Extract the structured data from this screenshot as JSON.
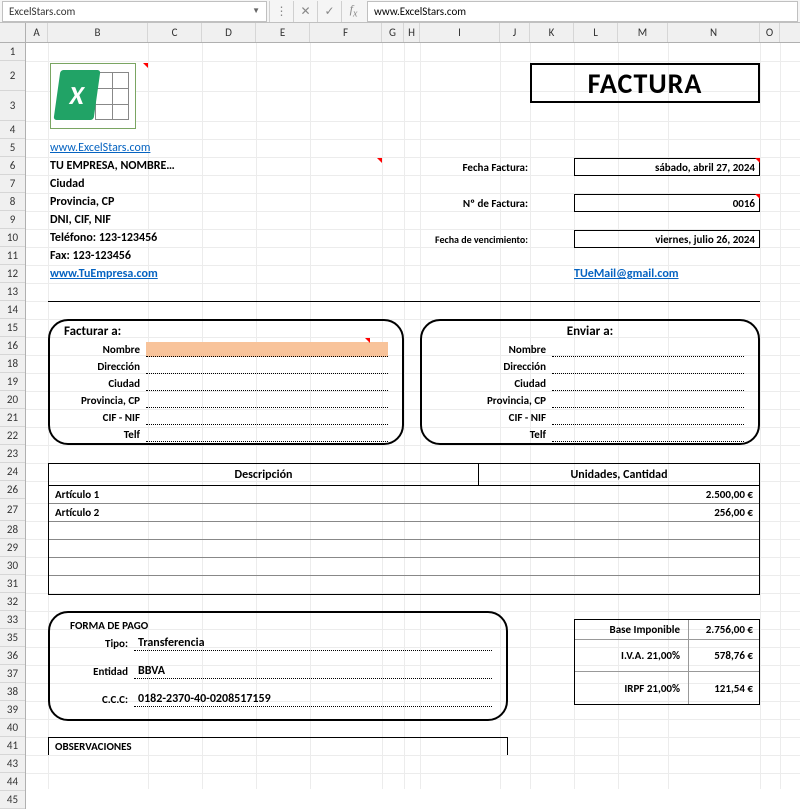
{
  "formula_bar": {
    "name_box": "ExcelStars.com",
    "formula": "www.ExcelStars.com"
  },
  "columns": [
    "A",
    "B",
    "C",
    "D",
    "E",
    "F",
    "G",
    "H",
    "I",
    "J",
    "K",
    "L",
    "M",
    "N",
    "O"
  ],
  "rows": [
    "1",
    "2",
    "3",
    "4",
    "5",
    "6",
    "7",
    "8",
    "9",
    "10",
    "11",
    "12",
    "13",
    "14",
    "15",
    "16",
    "18",
    "19",
    "20",
    "21",
    "22",
    "23",
    "24",
    "26",
    "27",
    "28",
    "29",
    "30",
    "31",
    "32",
    "33",
    "35",
    "36",
    "37",
    "38",
    "39",
    "40",
    "41",
    "43",
    "44",
    "45"
  ],
  "header": {
    "title": "FACTURA",
    "link_site": "www.ExcelStars.com",
    "company_name": "TU EMPRESA, NOMBRE…",
    "city": "Ciudad",
    "province": "Provincia, CP",
    "idnum": "DNI, CIF, NIF",
    "phone": "Teléfono: 123-123456",
    "fax": "Fax: 123-123456",
    "company_link": "www.TuEmpresa.com",
    "email_link": "TUeMail@gmail.com"
  },
  "fields": {
    "date_label": "Fecha Factura:",
    "date_value": "sábado, abril 27, 2024",
    "num_label": "Nº de Factura:",
    "num_value": "0016",
    "due_label": "Fecha de vencimiento:",
    "due_value": "viernes, julio 26, 2024"
  },
  "bill_to": {
    "title": "Facturar a:",
    "labels": {
      "name": "Nombre",
      "addr": "Dirección",
      "city": "Ciudad",
      "prov": "Provincia, CP",
      "cif": "CIF - NIF",
      "tel": "Telf"
    }
  },
  "ship_to": {
    "title": "Enviar a:",
    "labels": {
      "name": "Nombre",
      "addr": "Dirección",
      "city": "Ciudad",
      "prov": "Provincia, CP",
      "cif": "CIF - NIF",
      "tel": "Telf"
    }
  },
  "table": {
    "col1": "Descripción",
    "col2": "Unidades, Cantidad",
    "rows": [
      {
        "desc": "Artículo 1",
        "amount": "2.500,00 €"
      },
      {
        "desc": "Artículo 2",
        "amount": "256,00 €"
      },
      {
        "desc": "",
        "amount": ""
      },
      {
        "desc": "",
        "amount": ""
      },
      {
        "desc": "",
        "amount": ""
      },
      {
        "desc": "",
        "amount": ""
      }
    ]
  },
  "payment": {
    "title": "FORMA DE PAGO",
    "type_label": "Tipo:",
    "type_value": "Transferencia",
    "bank_label": "Entidad",
    "bank_value": "BBVA",
    "ccc_label": "C.C.C:",
    "ccc_value": "0182-2370-40-0208517159"
  },
  "totals": {
    "base_label": "Base Imponible",
    "base_value": "2.756,00 €",
    "iva_label": "I.V.A.  21,00%",
    "iva_value": "578,76 €",
    "irpf_label": "IRPF  21,00%",
    "irpf_value": "121,54 €"
  },
  "obs": {
    "title": "OBSERVACIONES"
  },
  "chart_data": {
    "type": "table",
    "title": "FACTURA",
    "line_items": [
      {
        "Descripción": "Artículo 1",
        "Unidades, Cantidad": 2500.0
      },
      {
        "Descripción": "Artículo 2",
        "Unidades, Cantidad": 256.0
      }
    ],
    "totals": {
      "Base Imponible": 2756.0,
      "I.V.A. 21,00%": 578.76,
      "IRPF 21,00%": 121.54
    },
    "currency": "€"
  }
}
